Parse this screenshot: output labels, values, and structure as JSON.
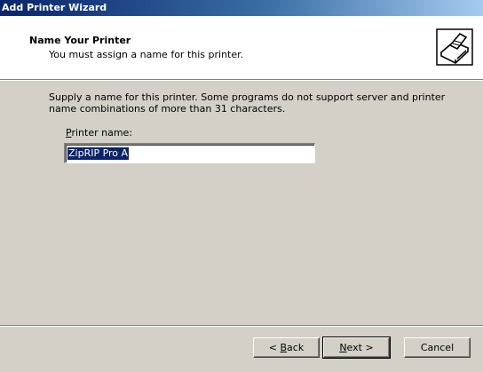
{
  "window": {
    "title": "Add Printer Wizard"
  },
  "header": {
    "title": "Name Your Printer",
    "subtitle": "You must assign a name for this printer.",
    "icon": "printer-wizard-icon"
  },
  "body": {
    "description": "Supply a name for this printer. Some programs do not support server and printer name combinations of more than 31 characters.",
    "printer_name_label": {
      "mnemonic": "P",
      "rest": "rinter name:"
    },
    "printer_name_value": "ZipRIP Pro A"
  },
  "buttons": {
    "back": {
      "prefix": "< ",
      "mnemonic": "B",
      "rest": "ack"
    },
    "next": {
      "mnemonic": "N",
      "rest": "ext >"
    },
    "cancel": "Cancel"
  }
}
